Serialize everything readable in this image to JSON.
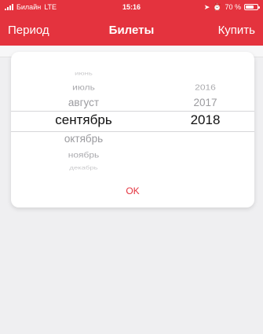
{
  "status_bar": {
    "carrier": "Билайн",
    "network": "LTE",
    "time": "15:16",
    "battery_percent_text": "70 %",
    "battery_level": 0.7,
    "signal_bars": 4
  },
  "nav": {
    "left_label": "Период",
    "title": "Билеты",
    "right_label": "Купить"
  },
  "picker": {
    "months": [
      "июнь",
      "июль",
      "август",
      "сентябрь",
      "октябрь",
      "ноябрь",
      "декабрь"
    ],
    "selected_month": "сентябрь",
    "years": [
      "2016",
      "2017",
      "2018"
    ],
    "selected_year": "2018",
    "ok_label": "OK"
  },
  "colors": {
    "accent": "#e4333e",
    "background": "#efeff1",
    "card": "#ffffff",
    "muted_text": "#9b9b9f",
    "selected_text": "#111111"
  }
}
